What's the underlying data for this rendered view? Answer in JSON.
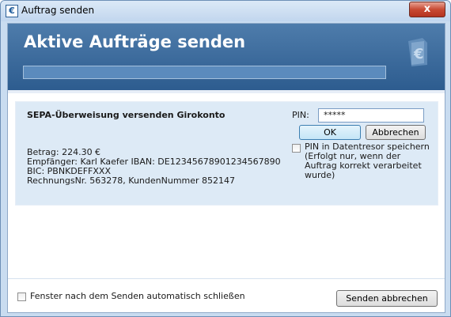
{
  "window": {
    "title": "Auftrag senden",
    "close_glyph": "x"
  },
  "banner": {
    "title": "Aktive Aufträge senden",
    "progress": 0,
    "logo": "euro-document-icon"
  },
  "order": {
    "title": "SEPA-Überweisung versenden Girokonto",
    "amount": "Betrag: 224.30 €",
    "recipient": "Empfänger: Karl Kaefer IBAN: DE12345678901234567890",
    "bic": "BIC: PBNKDEFFXXX",
    "reference": "RechnungsNr. 563278, KundenNummer 852147"
  },
  "pin": {
    "label": "PIN:",
    "value": "*****",
    "ok_label": "OK",
    "cancel_label": "Abbrechen",
    "save_label": "PIN in Datentresor speichern (Erfolgt nur, wenn der Auftrag korrekt verarbeitet wurde)",
    "save_checked": false
  },
  "footer": {
    "auto_close_label": "Fenster nach dem Senden automatisch schließen",
    "auto_close_checked": false,
    "stop_label": "Senden abbrechen"
  },
  "colors": {
    "banner": "#3f6fa0",
    "panel": "#ddeaf6",
    "frame": "#c9dcf0",
    "close": "#c84a33"
  }
}
